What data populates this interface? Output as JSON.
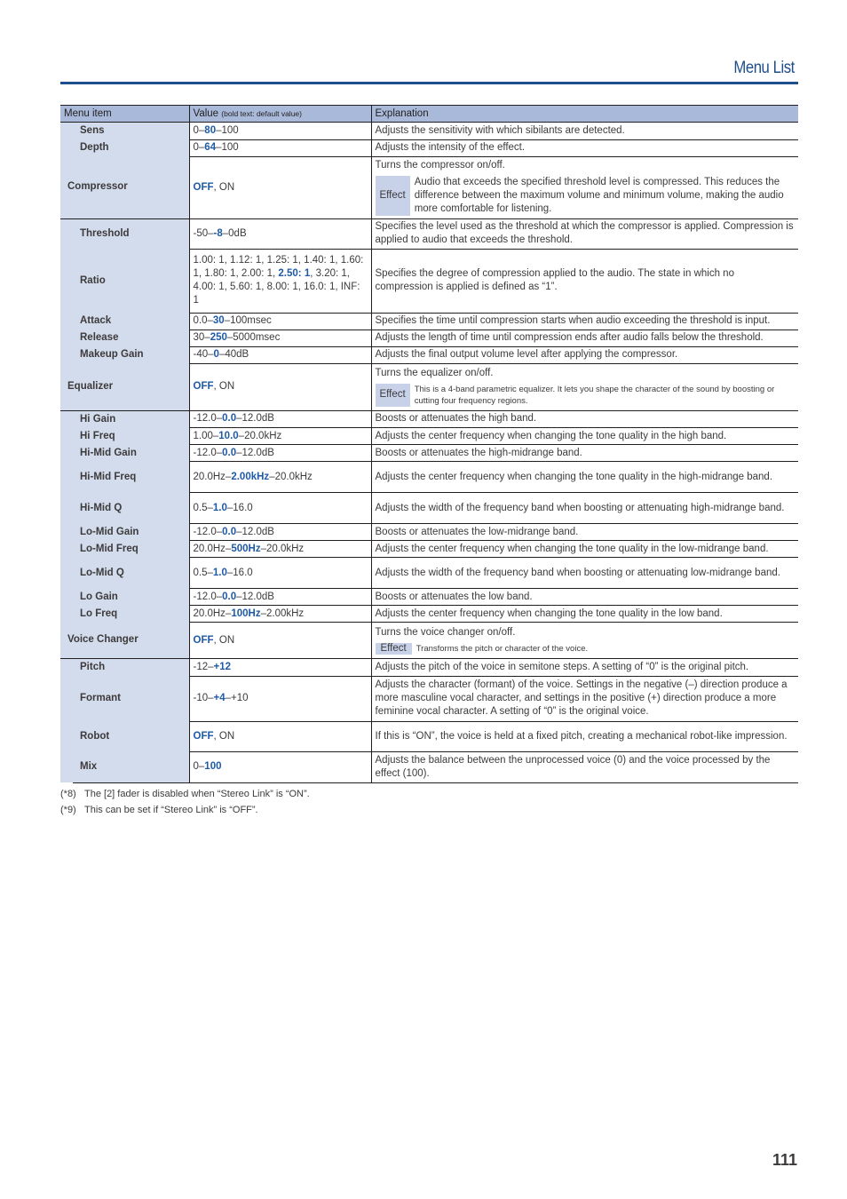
{
  "header": {
    "title": "Menu List"
  },
  "table": {
    "columns": {
      "item": "Menu item",
      "value": "Value",
      "value_note": "(bold text: default value)",
      "explanation": "Explanation"
    },
    "rows": [
      {
        "item": "Sens",
        "sub": true,
        "value": [
          [
            "0–",
            false
          ],
          [
            "80",
            true
          ],
          [
            "–100",
            false
          ]
        ],
        "explanation": "Adjusts the sensitivity with which sibilants are detected."
      },
      {
        "item": "Depth",
        "sub": true,
        "value": [
          [
            "0–",
            false
          ],
          [
            "64",
            true
          ],
          [
            "–100",
            false
          ]
        ],
        "explanation": "Adjusts the intensity of the effect."
      },
      {
        "item": "Compressor",
        "sub": false,
        "value": [
          [
            "OFF",
            true
          ],
          [
            ", ON",
            false
          ]
        ],
        "explanation": "Turns the compressor on/off.",
        "effect": {
          "label": "Effect",
          "text": "Audio that exceeds the specified threshold level is compressed. This reduces the difference between the maximum volume and minimum volume, making the audio more comfortable for listening.",
          "small": false
        }
      },
      {
        "item": "Threshold",
        "sub": true,
        "value": [
          [
            "-50–",
            false
          ],
          [
            "-8",
            true
          ],
          [
            "–0dB",
            false
          ]
        ],
        "explanation": "Specifies the level used as the threshold at which the compressor is applied. Compression is applied to audio that exceeds the threshold."
      },
      {
        "item": "Ratio",
        "sub": true,
        "value": [
          [
            "1.00: 1, 1.12: 1, 1.25: 1, 1.40: 1, 1.60: 1, 1.80: 1, 2.00: 1, ",
            false
          ],
          [
            "2.50: 1",
            true
          ],
          [
            ", 3.20: 1, 4.00: 1, 5.60: 1, 8.00: 1, 16.0: 1, INF: 1",
            false
          ]
        ],
        "explanation": "Specifies the degree of compression applied to the audio. The state in which no compression is applied is defined as “1”."
      },
      {
        "item": "Attack",
        "sub": true,
        "value": [
          [
            "0.0–",
            false
          ],
          [
            "30",
            true
          ],
          [
            "–100msec",
            false
          ]
        ],
        "explanation": "Specifies the time until compression starts when audio exceeding the threshold is input."
      },
      {
        "item": "Release",
        "sub": true,
        "value": [
          [
            "30–",
            false
          ],
          [
            "250",
            true
          ],
          [
            "–5000msec",
            false
          ]
        ],
        "explanation": "Adjusts the length of time until compression ends after audio falls below the threshold."
      },
      {
        "item": "Makeup Gain",
        "sub": true,
        "value": [
          [
            "-40–",
            false
          ],
          [
            "0",
            true
          ],
          [
            "–40dB",
            false
          ]
        ],
        "explanation": "Adjusts the final output volume level after applying the compressor."
      },
      {
        "item": "Equalizer",
        "sub": false,
        "value": [
          [
            "OFF",
            true
          ],
          [
            ", ON",
            false
          ]
        ],
        "explanation": "Turns the equalizer on/off.",
        "effect": {
          "label": "Effect",
          "text": "This is a 4-band parametric equalizer. It lets you shape the character of the sound by boosting or cutting four frequency regions.",
          "small": true
        }
      },
      {
        "item": "Hi Gain",
        "sub": true,
        "value": [
          [
            "-12.0–",
            false
          ],
          [
            "0.0",
            true
          ],
          [
            "–12.0dB",
            false
          ]
        ],
        "explanation": "Boosts or attenuates the high band."
      },
      {
        "item": "Hi Freq",
        "sub": true,
        "value": [
          [
            "1.00–",
            false
          ],
          [
            "10.0",
            true
          ],
          [
            "–20.0kHz",
            false
          ]
        ],
        "explanation": "Adjusts the center frequency when changing the tone quality in the high band."
      },
      {
        "item": "Hi-Mid Gain",
        "sub": true,
        "value": [
          [
            "-12.0–",
            false
          ],
          [
            "0.0",
            true
          ],
          [
            "–12.0dB",
            false
          ]
        ],
        "explanation": "Boosts or attenuates the high-midrange band."
      },
      {
        "item": "Hi-Mid Freq",
        "sub": true,
        "value": [
          [
            "20.0Hz–",
            false
          ],
          [
            "2.00kHz",
            true
          ],
          [
            "–20.0kHz",
            false
          ]
        ],
        "explanation": "Adjusts the center frequency when changing the tone quality in the high-midrange band."
      },
      {
        "item": "Hi-Mid Q",
        "sub": true,
        "value": [
          [
            "0.5–",
            false
          ],
          [
            "1.0",
            true
          ],
          [
            "–16.0",
            false
          ]
        ],
        "explanation": "Adjusts the width of the frequency band when boosting or attenuating high-midrange band."
      },
      {
        "item": "Lo-Mid Gain",
        "sub": true,
        "value": [
          [
            "-12.0–",
            false
          ],
          [
            "0.0",
            true
          ],
          [
            "–12.0dB",
            false
          ]
        ],
        "explanation": "Boosts or attenuates the low-midrange band."
      },
      {
        "item": "Lo-Mid Freq",
        "sub": true,
        "value": [
          [
            "20.0Hz–",
            false
          ],
          [
            "500Hz",
            true
          ],
          [
            "–20.0kHz",
            false
          ]
        ],
        "explanation": "Adjusts the center frequency when changing the tone quality in the low-midrange band."
      },
      {
        "item": "Lo-Mid Q",
        "sub": true,
        "value": [
          [
            "0.5–",
            false
          ],
          [
            "1.0",
            true
          ],
          [
            "–16.0",
            false
          ]
        ],
        "explanation": "Adjusts the width of the frequency band when boosting or attenuating low-midrange band."
      },
      {
        "item": "Lo Gain",
        "sub": true,
        "value": [
          [
            "-12.0–",
            false
          ],
          [
            "0.0",
            true
          ],
          [
            "–12.0dB",
            false
          ]
        ],
        "explanation": "Boosts or attenuates the low band."
      },
      {
        "item": "Lo Freq",
        "sub": true,
        "value": [
          [
            "20.0Hz–",
            false
          ],
          [
            "100Hz",
            true
          ],
          [
            "–2.00kHz",
            false
          ]
        ],
        "explanation": "Adjusts the center frequency when changing the tone quality in the low band."
      },
      {
        "item": "Voice Changer",
        "sub": false,
        "value": [
          [
            "OFF",
            true
          ],
          [
            ", ON",
            false
          ]
        ],
        "explanation": "Turns the voice changer on/off.",
        "effect": {
          "label": "Effect",
          "text": "Transforms the pitch or character of the voice.",
          "small": true,
          "inline": true
        }
      },
      {
        "item": "Pitch",
        "sub": true,
        "value": [
          [
            "-12–",
            false
          ],
          [
            "+12",
            true
          ]
        ],
        "explanation": "Adjusts the pitch of the voice in semitone steps. A setting of “0” is the original pitch."
      },
      {
        "item": "Formant",
        "sub": true,
        "value": [
          [
            "-10–",
            false
          ],
          [
            "+4",
            true
          ],
          [
            "–+10",
            false
          ]
        ],
        "explanation": "Adjusts the character (formant) of the voice. Settings in the negative (–) direction produce a more masculine vocal character, and settings in the positive (+) direction produce a more feminine vocal character. A setting of “0” is the original voice."
      },
      {
        "item": "Robot",
        "sub": true,
        "value": [
          [
            "OFF",
            true
          ],
          [
            ", ON",
            false
          ]
        ],
        "explanation": "If this is “ON”, the voice is held at a fixed pitch, creating a mechanical robot-like impression."
      },
      {
        "item": "Mix",
        "sub": true,
        "value": [
          [
            "0–",
            false
          ],
          [
            "100",
            true
          ]
        ],
        "explanation": "Adjusts the balance between the unprocessed voice (0) and the voice processed by the effect (100)."
      }
    ]
  },
  "footnotes": [
    {
      "mark": "(*8)",
      "text": "The [2] fader is disabled when “Stereo Link” is “ON”."
    },
    {
      "mark": "(*9)",
      "text": "This can be set if “Stereo Link” is “OFF”."
    }
  ],
  "page_number": "111"
}
